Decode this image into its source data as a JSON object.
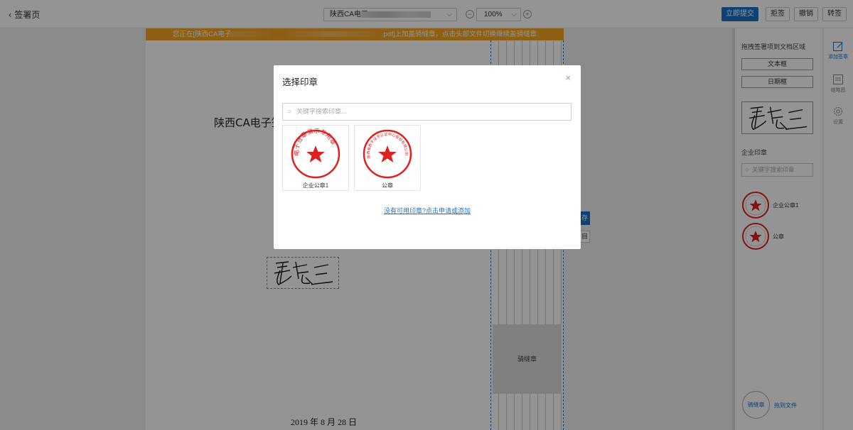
{
  "header": {
    "back_label": "签署页",
    "file_name": "陕西CA电子",
    "zoom_value": "100%",
    "submit_label": "立即提交",
    "reject_label": "拒签",
    "revoke_label": "撤销",
    "transfer_label": "转签"
  },
  "notice": {
    "prefix": "您正在[陕西CA电子",
    "suffix": ".pdf]上加盖骑缝章，点击头部文件切换继续盖骑缝章"
  },
  "document": {
    "title": "陕西CA电子签",
    "date": "2019 年 8 月 28 日",
    "riding_seal_label": "骑缝章",
    "side_btn1": "存",
    "side_btn2": "目"
  },
  "right_panel": {
    "drag_title": "拖拽签署项到文档区域",
    "text_field": "文本框",
    "date_field": "日期框",
    "enterprise_section": "企业印章",
    "search_placeholder": "关键字搜索印章",
    "seals": [
      {
        "name": "企业公章1"
      },
      {
        "name": "公章"
      }
    ],
    "riding_circle": "骑缝章",
    "drag_file": "拖到文件"
  },
  "toolbar": {
    "add_sign": "添加签章",
    "thumbnail": "缩略图",
    "settings": "设置"
  },
  "modal": {
    "title": "选择印章",
    "close": "×",
    "search_placeholder": "关键字搜索印章...",
    "seals": [
      {
        "name": "企业公章1",
        "ring_text": "电子签章演示专用章"
      },
      {
        "name": "公章",
        "ring_text": "陕西省数字证书认证中心股份有限公司"
      }
    ],
    "apply_link": "没有可用印章?点击申请或添加"
  },
  "colors": {
    "primary": "#1a73c8",
    "notice_bg": "#f5a623",
    "seal_red": "#e02020"
  }
}
